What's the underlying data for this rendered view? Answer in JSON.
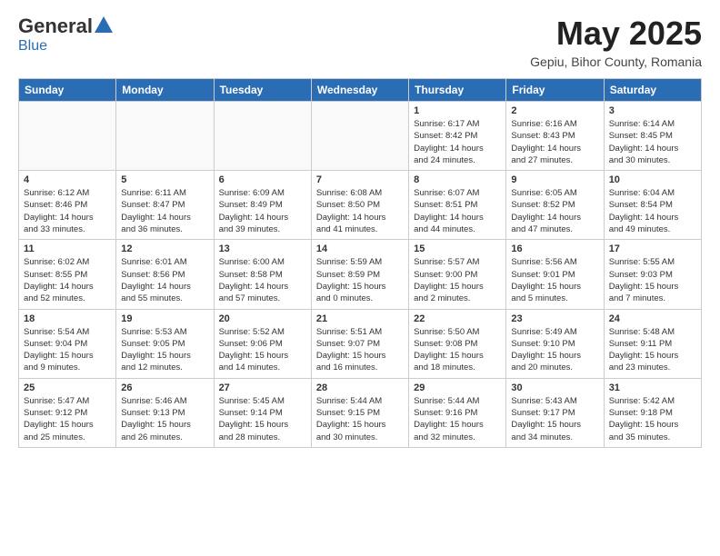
{
  "header": {
    "logo_general": "General",
    "logo_blue": "Blue",
    "month_title": "May 2025",
    "subtitle": "Gepiu, Bihor County, Romania"
  },
  "weekdays": [
    "Sunday",
    "Monday",
    "Tuesday",
    "Wednesday",
    "Thursday",
    "Friday",
    "Saturday"
  ],
  "weeks": [
    [
      {
        "day": "",
        "info": ""
      },
      {
        "day": "",
        "info": ""
      },
      {
        "day": "",
        "info": ""
      },
      {
        "day": "",
        "info": ""
      },
      {
        "day": "1",
        "info": "Sunrise: 6:17 AM\nSunset: 8:42 PM\nDaylight: 14 hours\nand 24 minutes."
      },
      {
        "day": "2",
        "info": "Sunrise: 6:16 AM\nSunset: 8:43 PM\nDaylight: 14 hours\nand 27 minutes."
      },
      {
        "day": "3",
        "info": "Sunrise: 6:14 AM\nSunset: 8:45 PM\nDaylight: 14 hours\nand 30 minutes."
      }
    ],
    [
      {
        "day": "4",
        "info": "Sunrise: 6:12 AM\nSunset: 8:46 PM\nDaylight: 14 hours\nand 33 minutes."
      },
      {
        "day": "5",
        "info": "Sunrise: 6:11 AM\nSunset: 8:47 PM\nDaylight: 14 hours\nand 36 minutes."
      },
      {
        "day": "6",
        "info": "Sunrise: 6:09 AM\nSunset: 8:49 PM\nDaylight: 14 hours\nand 39 minutes."
      },
      {
        "day": "7",
        "info": "Sunrise: 6:08 AM\nSunset: 8:50 PM\nDaylight: 14 hours\nand 41 minutes."
      },
      {
        "day": "8",
        "info": "Sunrise: 6:07 AM\nSunset: 8:51 PM\nDaylight: 14 hours\nand 44 minutes."
      },
      {
        "day": "9",
        "info": "Sunrise: 6:05 AM\nSunset: 8:52 PM\nDaylight: 14 hours\nand 47 minutes."
      },
      {
        "day": "10",
        "info": "Sunrise: 6:04 AM\nSunset: 8:54 PM\nDaylight: 14 hours\nand 49 minutes."
      }
    ],
    [
      {
        "day": "11",
        "info": "Sunrise: 6:02 AM\nSunset: 8:55 PM\nDaylight: 14 hours\nand 52 minutes."
      },
      {
        "day": "12",
        "info": "Sunrise: 6:01 AM\nSunset: 8:56 PM\nDaylight: 14 hours\nand 55 minutes."
      },
      {
        "day": "13",
        "info": "Sunrise: 6:00 AM\nSunset: 8:58 PM\nDaylight: 14 hours\nand 57 minutes."
      },
      {
        "day": "14",
        "info": "Sunrise: 5:59 AM\nSunset: 8:59 PM\nDaylight: 15 hours\nand 0 minutes."
      },
      {
        "day": "15",
        "info": "Sunrise: 5:57 AM\nSunset: 9:00 PM\nDaylight: 15 hours\nand 2 minutes."
      },
      {
        "day": "16",
        "info": "Sunrise: 5:56 AM\nSunset: 9:01 PM\nDaylight: 15 hours\nand 5 minutes."
      },
      {
        "day": "17",
        "info": "Sunrise: 5:55 AM\nSunset: 9:03 PM\nDaylight: 15 hours\nand 7 minutes."
      }
    ],
    [
      {
        "day": "18",
        "info": "Sunrise: 5:54 AM\nSunset: 9:04 PM\nDaylight: 15 hours\nand 9 minutes."
      },
      {
        "day": "19",
        "info": "Sunrise: 5:53 AM\nSunset: 9:05 PM\nDaylight: 15 hours\nand 12 minutes."
      },
      {
        "day": "20",
        "info": "Sunrise: 5:52 AM\nSunset: 9:06 PM\nDaylight: 15 hours\nand 14 minutes."
      },
      {
        "day": "21",
        "info": "Sunrise: 5:51 AM\nSunset: 9:07 PM\nDaylight: 15 hours\nand 16 minutes."
      },
      {
        "day": "22",
        "info": "Sunrise: 5:50 AM\nSunset: 9:08 PM\nDaylight: 15 hours\nand 18 minutes."
      },
      {
        "day": "23",
        "info": "Sunrise: 5:49 AM\nSunset: 9:10 PM\nDaylight: 15 hours\nand 20 minutes."
      },
      {
        "day": "24",
        "info": "Sunrise: 5:48 AM\nSunset: 9:11 PM\nDaylight: 15 hours\nand 23 minutes."
      }
    ],
    [
      {
        "day": "25",
        "info": "Sunrise: 5:47 AM\nSunset: 9:12 PM\nDaylight: 15 hours\nand 25 minutes."
      },
      {
        "day": "26",
        "info": "Sunrise: 5:46 AM\nSunset: 9:13 PM\nDaylight: 15 hours\nand 26 minutes."
      },
      {
        "day": "27",
        "info": "Sunrise: 5:45 AM\nSunset: 9:14 PM\nDaylight: 15 hours\nand 28 minutes."
      },
      {
        "day": "28",
        "info": "Sunrise: 5:44 AM\nSunset: 9:15 PM\nDaylight: 15 hours\nand 30 minutes."
      },
      {
        "day": "29",
        "info": "Sunrise: 5:44 AM\nSunset: 9:16 PM\nDaylight: 15 hours\nand 32 minutes."
      },
      {
        "day": "30",
        "info": "Sunrise: 5:43 AM\nSunset: 9:17 PM\nDaylight: 15 hours\nand 34 minutes."
      },
      {
        "day": "31",
        "info": "Sunrise: 5:42 AM\nSunset: 9:18 PM\nDaylight: 15 hours\nand 35 minutes."
      }
    ]
  ]
}
